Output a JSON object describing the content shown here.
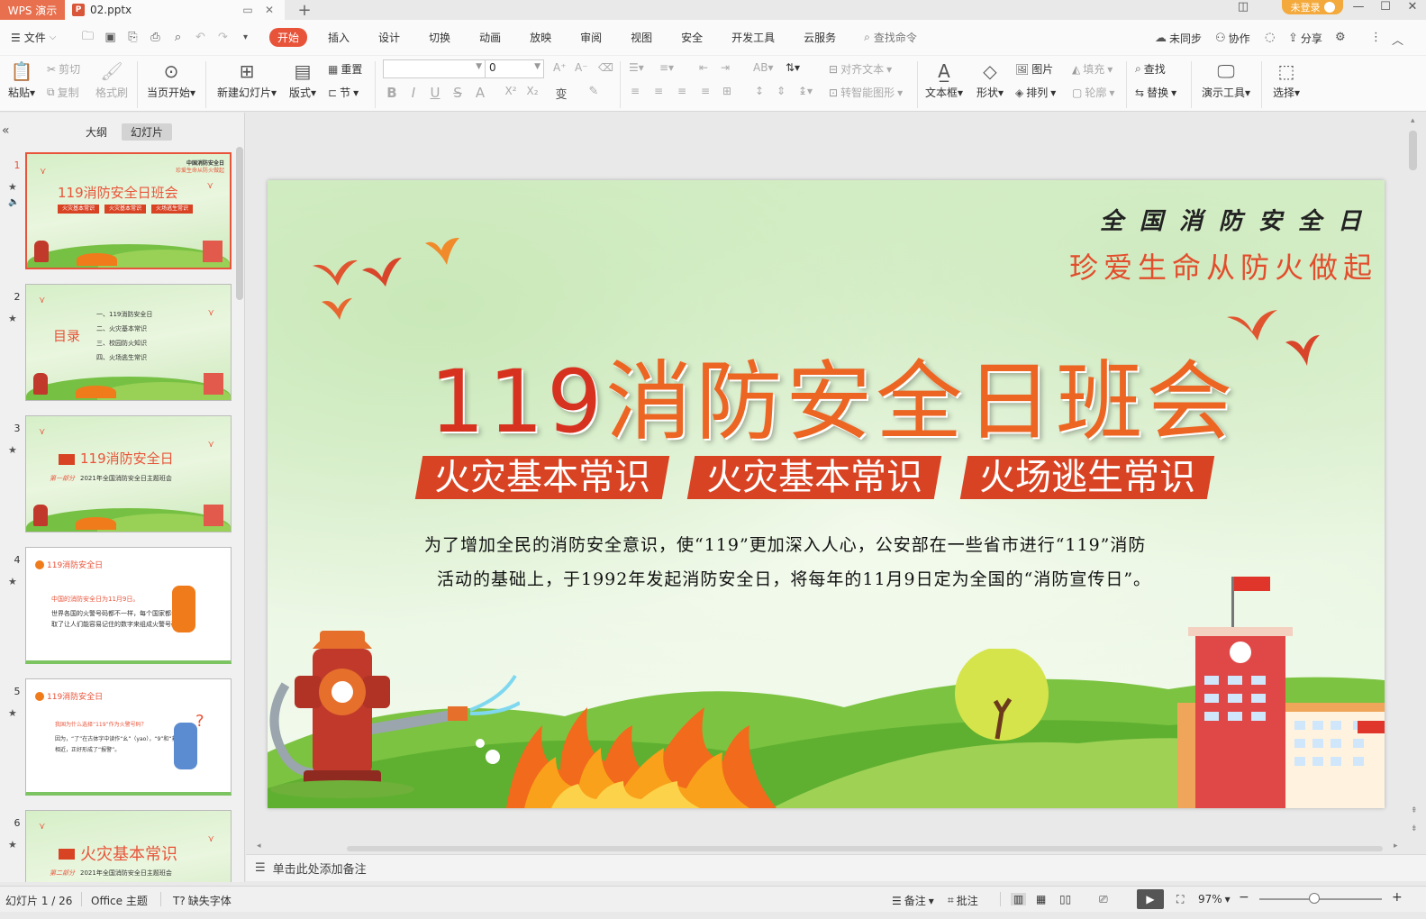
{
  "titlebar": {
    "app_name": "WPS 演示",
    "doc_name": "02.pptx",
    "login_label": "未登录"
  },
  "menubar": {
    "file_label": "文件",
    "tabs": [
      "开始",
      "插入",
      "设计",
      "切换",
      "动画",
      "放映",
      "审阅",
      "视图",
      "安全",
      "开发工具",
      "云服务"
    ],
    "active_tab": "开始",
    "search_placeholder": "查找命令",
    "right": {
      "sync": "未同步",
      "collab": "协作",
      "share": "分享"
    }
  },
  "toolbar": {
    "paste": "粘贴",
    "cut": "剪切",
    "copy": "复制",
    "format_painter": "格式刷",
    "from_current": "当页开始",
    "new_slide": "新建幻灯片",
    "layout": "版式",
    "reset": "重置",
    "section": "节",
    "font_size_value": "0",
    "align_text": "对齐文本",
    "to_smartart": "转智能图形",
    "textbox": "文本框",
    "shape": "形状",
    "picture": "图片",
    "arrange": "排列",
    "fill": "填充",
    "outline": "轮廓",
    "find": "查找",
    "replace": "替换",
    "present_tools": "演示工具",
    "select": "选择"
  },
  "leftpanel": {
    "tab_outline": "大纲",
    "tab_slides": "幻灯片",
    "thumbnails": [
      {
        "num": "1",
        "title": "119消防安全日班会",
        "top1": "中国消防安全日",
        "top2": "珍爱生命从防火做起",
        "pills": [
          "火灾基本常识",
          "火灾基本常识",
          "火场逃生常识"
        ]
      },
      {
        "num": "2",
        "title": "目录",
        "items": [
          "一、119消防安全日",
          "二、火灾基本常识",
          "三、校园防火知识",
          "四、火场逃生常识"
        ]
      },
      {
        "num": "3",
        "title": "119消防安全日",
        "sub": "2021年全国消防安全日主题班会",
        "part": "第一部分"
      },
      {
        "num": "4",
        "header": "119消防安全日",
        "lines": [
          "中国的消防安全日为11月9日。",
          "世界各国的火警号码都不一样，每个国家都会",
          "取了让人们能容易记住的数字来组成火警号码。"
        ]
      },
      {
        "num": "5",
        "header": "119消防安全日",
        "lines": [
          "我国为什么选择“119”作为火警号码？",
          "因为，“了”在古体字中读作“幺”（yao），“9”和“救”读音",
          "相近，正好形成了“报警”。"
        ]
      },
      {
        "num": "6",
        "title": "火灾基本常识",
        "sub": "2021年全国消防安全日主题班会",
        "part": "第二部分"
      }
    ]
  },
  "slide": {
    "top_line1": "全国消防安全日",
    "top_line2": "珍爱生命从防火做起",
    "title_num": "119",
    "title_text": "消防安全日班会",
    "pills": [
      "火灾基本常识",
      "火灾基本常识",
      "火场逃生常识"
    ],
    "para_line1": "为了增加全民的消防安全意识，使“119”更加深入人心，公安部在一些省市进行“119”消防",
    "para_line2": "活动的基础上，于1992年发起消防安全日，将每年的11月9日定为全国的“消防宣传日”。"
  },
  "notes": {
    "placeholder": "单击此处添加备注"
  },
  "statusbar": {
    "slide_counter": "幻灯片 1 / 26",
    "theme": "Office 主题",
    "missing_fonts": "缺失字体",
    "notes": "备注",
    "comments": "批注",
    "zoom": "97%",
    "zoom_fraction": 0.45
  },
  "colors": {
    "accent": "#e8543a",
    "login": "#f3a93b",
    "title_orange": "#ec6522",
    "pill_red": "#d84323"
  }
}
